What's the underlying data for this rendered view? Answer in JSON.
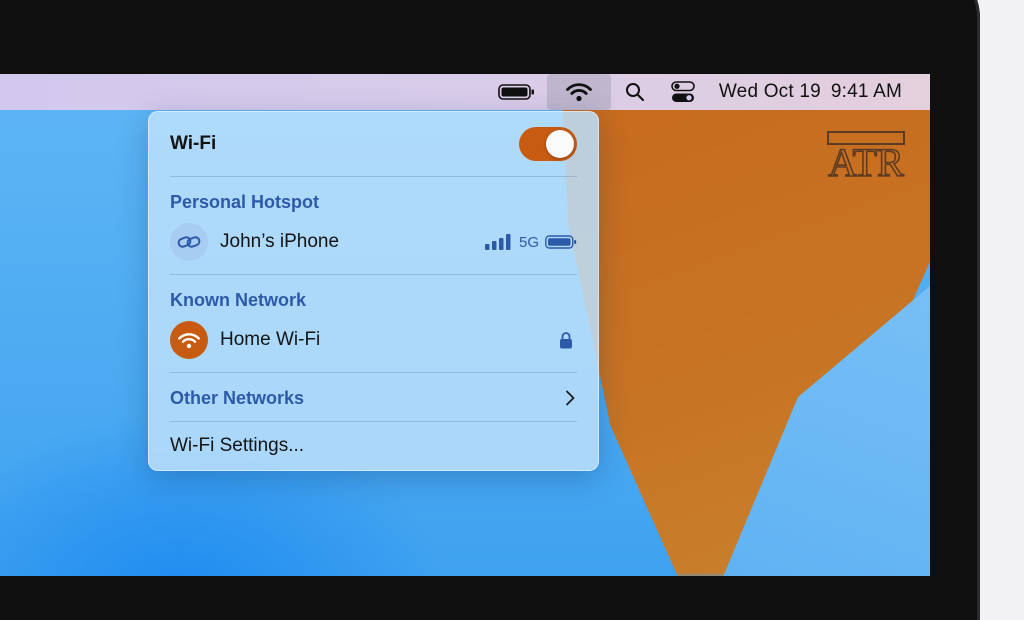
{
  "menubar": {
    "date": "Wed Oct 19",
    "time": "9:41 AM",
    "icons": [
      "battery-icon",
      "wifi-icon",
      "search-icon",
      "control-center-icon"
    ]
  },
  "wifi_menu": {
    "title": "Wi-Fi",
    "toggle_on": true,
    "personal_hotspot": {
      "section_label": "Personal Hotspot",
      "device_name": "John’s iPhone",
      "network_type": "5G",
      "signal_bars": 4
    },
    "known_network": {
      "section_label": "Known Network",
      "name": "Home Wi-Fi",
      "secured": true
    },
    "other_networks_label": "Other Networks",
    "settings_label": "Wi-Fi Settings..."
  },
  "watermark": {
    "text": "ATR"
  },
  "colors": {
    "accent": "#c85b12",
    "section_text": "#2d5aa8",
    "panel_bg": "#bce0fc",
    "menubar": "#d6caec"
  }
}
